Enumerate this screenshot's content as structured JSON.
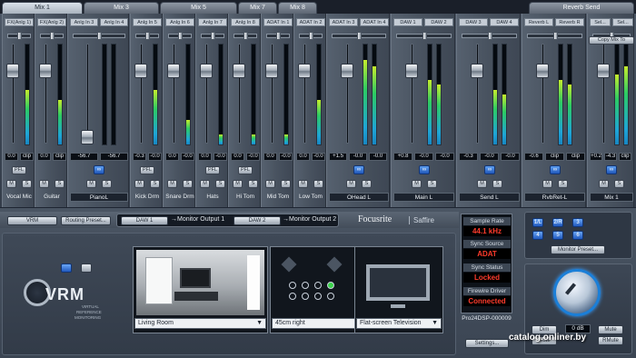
{
  "tabs": [
    "Mix 1",
    "Mix 3",
    "Mix 5",
    "Mix 7",
    "Mix 8",
    "Reverb Send"
  ],
  "strips": [
    {
      "ch": [
        "FX(Anlg 1)"
      ],
      "label": "Vocal Mic",
      "vals": [
        "0.0",
        "clip"
      ],
      "pfl": true,
      "meters": [
        0.55
      ],
      "fader": 0.78
    },
    {
      "ch": [
        "FX(Anlg 2)"
      ],
      "label": "Guitar",
      "vals": [
        "0.0",
        "clip"
      ],
      "pfl": false,
      "meters": [
        0.45
      ],
      "fader": 0.78
    },
    {
      "ch": [
        "Anlg In 3",
        "Anlg In 4"
      ],
      "label": "PianoL",
      "vals": [
        "-56.7",
        "-56.7"
      ],
      "pfl": true,
      "meters": [
        0.0,
        0.0
      ],
      "fader": 0.05
    },
    {
      "ch": [
        "Anlg In 5"
      ],
      "label": "Kick Drm",
      "vals": [
        "-0.3",
        "-0.0"
      ],
      "pfl": true,
      "meters": [
        0.6,
        0.55
      ],
      "fader": 0.78
    },
    {
      "ch": [
        "Anlg In 6"
      ],
      "label": "Snare Drm",
      "vals": [
        "0.0",
        "-0.0"
      ],
      "pfl": false,
      "meters": [
        0.5,
        0.25
      ],
      "fader": 0.78
    },
    {
      "ch": [
        "Anlg In 7"
      ],
      "label": "Hats",
      "vals": [
        "0.0",
        "-0.0"
      ],
      "pfl": true,
      "meters": [
        0.5,
        0.1
      ],
      "fader": 0.78
    },
    {
      "ch": [
        "Anlg In 8"
      ],
      "label": "Hi Tom",
      "vals": [
        "0.0",
        "-0.0"
      ],
      "pfl": true,
      "meters": [
        0.8,
        0.1
      ],
      "fader": 0.78
    },
    {
      "ch": [
        "ADAT In 1"
      ],
      "label": "Mid Tom",
      "vals": [
        "0.0",
        "-0.0"
      ],
      "pfl": false,
      "meters": [
        0.5,
        0.1
      ],
      "fader": 0.78
    },
    {
      "ch": [
        "ADAT In 2"
      ],
      "label": "Low Tom",
      "vals": [
        "0.0",
        "-0.0"
      ],
      "pfl": false,
      "meters": [
        0.5,
        0.45
      ],
      "fader": 0.78
    },
    {
      "ch": [
        "ADAT In 3",
        "ADAT In 4"
      ],
      "label": "OHead L",
      "vals": [
        "+1.5",
        "-0.0",
        "-0.0"
      ],
      "pfl": false,
      "meters": [
        0.85,
        0.78
      ],
      "fader": 0.78
    },
    {
      "ch": [
        "DAW 1",
        "DAW 2"
      ],
      "label": "Main L",
      "vals": [
        "+0.8",
        "-0.0",
        "-0.0"
      ],
      "pfl": false,
      "meters": [
        0.65,
        0.6
      ],
      "fader": 0.78
    },
    {
      "ch": [
        "DAW 3",
        "DAW 4"
      ],
      "label": "Send L",
      "vals": [
        "-0.3",
        "-0.0",
        "-0.0"
      ],
      "pfl": false,
      "meters": [
        0.55,
        0.5
      ],
      "fader": 0.78
    },
    {
      "ch": [
        "Reverb L",
        "Reverb R"
      ],
      "label": "RvbRet-L",
      "vals": [
        "-0.6",
        "clip",
        "clip"
      ],
      "pfl": false,
      "meters": [
        0.65,
        0.6
      ],
      "fader": 0.78
    },
    {
      "ch": [
        "Sel...",
        "Sel..."
      ],
      "label": "Mix 1",
      "vals": [
        "+0.2",
        "-4.3",
        "clip"
      ],
      "pfl": false,
      "meters": [
        0.7,
        0.78
      ],
      "fader": 0.78
    }
  ],
  "buttons": {
    "pfl": "PFL",
    "m": "M",
    "s": "S",
    "copy_mix_to": "Copy Mix To"
  },
  "routing": {
    "vrm_button": "VRM",
    "routing_preset": "Routing Preset...",
    "daw1": "DAW 1",
    "out1": "→Monitor Output 1",
    "daw2": "DAW 2",
    "out2": "→Monitor Output 2",
    "brand": "Focusrite",
    "product": "Saffire"
  },
  "vrm": {
    "title": "VRM",
    "sub1": "VIRTUAL",
    "sub2": "REFERENCE",
    "sub3": "MONITORING",
    "room": "Living Room",
    "position": "45cm right",
    "speaker": "Flat-screen Television"
  },
  "status": {
    "sample_rate_label": "Sample Rate",
    "sample_rate": "44.1 kHz",
    "sync_source_label": "Sync Source",
    "sync_source": "ADAT",
    "sync_status_label": "Sync Status",
    "sync_status": "Locked",
    "firewire_label": "Firewire Driver",
    "firewire": "Connected",
    "device": "Pro24DSP-000009",
    "settings": "Settings..."
  },
  "monitor": {
    "outputs": [
      "1/L",
      "2/R",
      "3",
      "4",
      "5",
      "6"
    ],
    "preset": "Monitor Preset...",
    "level": "0 dB",
    "dim": "Dim",
    "mute_left": "Mute",
    "mute": "Mute",
    "rmute": "RMute"
  },
  "watermark": "catalog.onliner.by"
}
